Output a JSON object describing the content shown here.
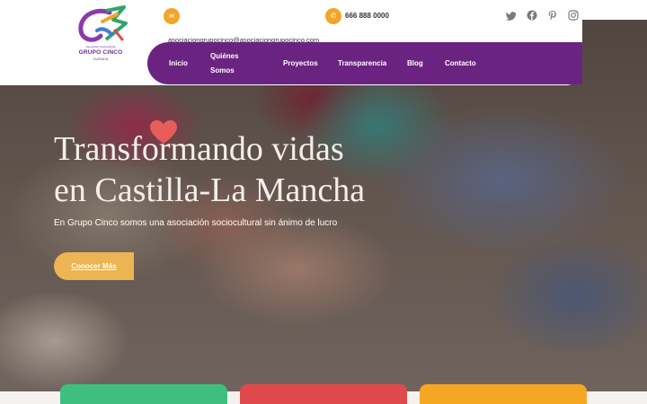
{
  "header": {
    "logo": {
      "tagline": "Asociación Sociocultural",
      "title": "GRUPO CINCO",
      "subtitle": "CUENCA"
    },
    "email": "asociaciongrupocinco@asociaciongrupocinco.com",
    "phone": "666 888 0000",
    "menu_icon": "list-icon",
    "phone_icon": "phone-icon",
    "social": [
      "twitter-icon",
      "facebook-icon",
      "pinterest-icon",
      "instagram-icon"
    ]
  },
  "nav": {
    "items": [
      {
        "label": "Inicio"
      },
      {
        "label": "Quiénes",
        "label2": "Somos"
      },
      {
        "label": "Proyectos"
      },
      {
        "label": "Transparencia"
      },
      {
        "label": "Blog"
      },
      {
        "label": "Contacto"
      }
    ]
  },
  "hero": {
    "title_line1": "Transformando vidas",
    "title_line2": "en Castilla-La Mancha",
    "subtitle": "En Grupo Cinco somos una asociación sociocultural sin ánimo de lucro",
    "cta": "Conocer Más",
    "heart_icon": "heart-icon"
  },
  "colors": {
    "purple": "#6a2381",
    "accent": "#f2a52a",
    "cta": "#ecb452",
    "heart": "#e85c5c",
    "card_green": "#3fbf7f",
    "card_red": "#e0494b",
    "card_orange": "#f5a623"
  }
}
